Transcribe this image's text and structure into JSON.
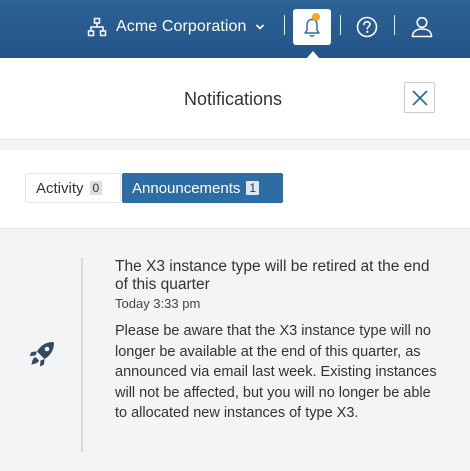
{
  "header": {
    "org_name": "Acme Corporation",
    "org_icon": "sitemap-icon",
    "notification_icon": "bell-icon",
    "notification_dot_color": "#f5a623",
    "help_icon": "help-circle-icon",
    "user_icon": "user-icon"
  },
  "panel": {
    "title": "Notifications",
    "close_icon": "close-icon"
  },
  "tabs": [
    {
      "label": "Activity",
      "count": "0",
      "selected": false
    },
    {
      "label": "Announcements",
      "count": "1",
      "selected": true
    }
  ],
  "announcement": {
    "icon": "rocket-icon",
    "title": "The X3 instance type will be retired at the end of this quarter",
    "time": "Today 3:33 pm",
    "body": "Please be aware that the X3 instance type will no longer be available at the end of this quarter, as announced via email last week. Existing instances will not be affected, but you will no longer be able to allocated new instances of type X3."
  },
  "colors": {
    "header_bg": "#2a5f93",
    "accent": "#2e6da4",
    "notification_dot": "#f5a623"
  }
}
